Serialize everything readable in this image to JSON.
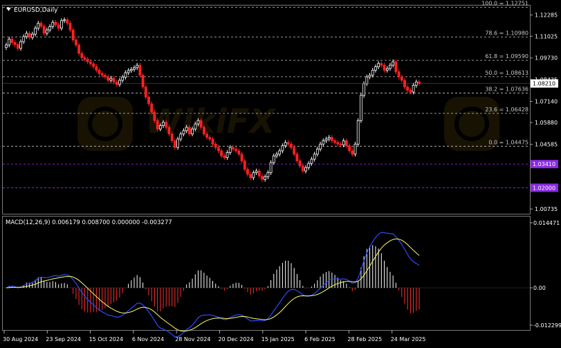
{
  "window": {
    "symbol_label": "EURUSD,Daily",
    "menu_icon": "triangle-down-icon"
  },
  "watermark": {
    "text": "WikiFX"
  },
  "colors": {
    "background": "#000000",
    "bull_candle": "#ffffff",
    "bear_candle": "#ff2020",
    "grid": "#555555",
    "fib_level": "#c8c8c8",
    "support_level": "#8a2be2",
    "macd_line": "#2a4bff",
    "signal_line": "#ffff66",
    "hist_positive": "#ffffff",
    "hist_negative": "#ff3030",
    "price_tag_bg": "#ffffff",
    "purple_tag_bg": "#8a2be2"
  },
  "price_axis": {
    "ticks": [
      "1.12285",
      "1.11025",
      "1.09730",
      "1.08435",
      "1.07140",
      "1.05880",
      "1.04585",
      "1.00735"
    ],
    "current_price": "1.08210"
  },
  "horizontal_levels": {
    "fib": [
      {
        "label": "100.0 = 1.12751",
        "value": 1.12751
      },
      {
        "label": "78.6 = 1.10980",
        "value": 1.1098
      },
      {
        "label": "61.8 = 1.09590",
        "value": 1.0959
      },
      {
        "label": "50.0 = 1.08613",
        "value": 1.08613
      },
      {
        "label": "38.2 = 1.07636",
        "value": 1.07636
      },
      {
        "label": "23.6 = 1.06428",
        "value": 1.06428
      },
      {
        "label": "0.0 = 1.04475",
        "value": 1.04475
      }
    ],
    "support": [
      {
        "tag": "1.03410",
        "value": 1.0341
      },
      {
        "tag": "1.02000",
        "value": 1.02
      }
    ]
  },
  "time_axis": {
    "labels": [
      "30 Aug 2024",
      "23 Sep 2024",
      "15 Oct 2024",
      "6 Nov 2024",
      "28 Nov 2024",
      "20 Dec 2024",
      "15 Jan 2025",
      "6 Feb 2025",
      "28 Feb 2025",
      "24 Mar 2025"
    ]
  },
  "macd": {
    "label": "MACD(12,26,9) 0.006179 0.008700 0.000000 -0.003277",
    "ticks": [
      "0.014471",
      "0.00",
      "-0.012299"
    ]
  },
  "chart_data": {
    "type": "candlestick",
    "series_name": "EURUSD",
    "timeframe": "Daily",
    "ylim": [
      1.0045,
      1.1285
    ],
    "close": [
      1.105,
      1.1085,
      1.1065,
      1.1052,
      1.103,
      1.107,
      1.11,
      1.112,
      1.1095,
      1.1115,
      1.115,
      1.118,
      1.1162,
      1.112,
      1.114,
      1.116,
      1.1185,
      1.117,
      1.115,
      1.1195,
      1.12,
      1.118,
      1.114,
      1.108,
      1.105,
      1.1,
      1.0975,
      1.0965,
      1.095,
      1.0938,
      1.0922,
      1.09,
      1.088,
      1.087,
      1.086,
      1.084,
      1.0852,
      1.083,
      1.0815,
      1.084,
      1.0858,
      1.0885,
      1.0898,
      1.0905,
      1.0915,
      1.093,
      1.087,
      1.08,
      1.074,
      1.07,
      1.065,
      1.06,
      1.055,
      1.057,
      1.059,
      1.056,
      1.052,
      1.048,
      1.044,
      1.049,
      1.052,
      1.054,
      1.056,
      1.052,
      1.055,
      1.058,
      1.06,
      1.056,
      1.052,
      1.05,
      1.049,
      1.046,
      1.044,
      1.042,
      1.039,
      1.038,
      1.041,
      1.044,
      1.043,
      1.042,
      1.04,
      1.036,
      1.031,
      1.028,
      1.026,
      1.029,
      1.03,
      1.027,
      1.025,
      1.0265,
      1.029,
      1.035,
      1.039,
      1.04,
      1.042,
      1.045,
      1.047,
      1.046,
      1.044,
      1.04,
      1.036,
      1.033,
      1.03,
      1.032,
      1.0345,
      1.037,
      1.04,
      1.043,
      1.046,
      1.048,
      1.049,
      1.05,
      1.048,
      1.047,
      1.046,
      1.0455,
      1.048,
      1.045,
      1.042,
      1.04,
      1.046,
      1.06,
      1.075,
      1.082,
      1.086,
      1.087,
      1.09,
      1.092,
      1.094,
      1.093,
      1.09,
      1.091,
      1.093,
      1.095,
      1.089,
      1.086,
      1.084,
      1.08,
      1.078,
      1.077,
      1.081,
      1.083,
      1.0821
    ]
  }
}
